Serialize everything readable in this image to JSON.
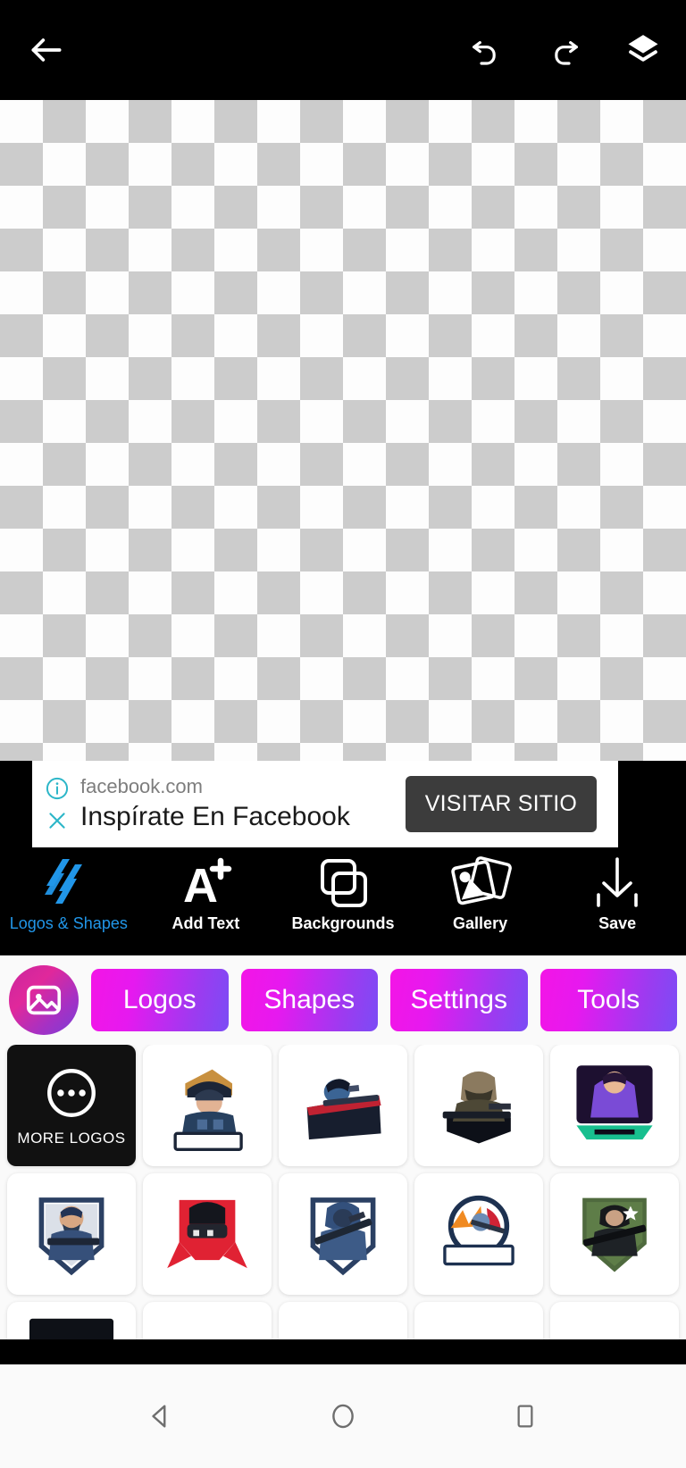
{
  "topbar": {
    "back_icon": "arrow-left-icon",
    "undo_icon": "undo-icon",
    "redo_icon": "redo-icon",
    "layers_icon": "layers-icon"
  },
  "canvas": {
    "state": "transparent-checkerboard"
  },
  "ad": {
    "info_icon": "info-icon",
    "close_icon": "close-icon",
    "url": "facebook.com",
    "title": "Inspírate En Facebook",
    "cta_label": "VISITAR SITIO",
    "cta_bg": "#3c3c3c",
    "accent": "#2cb6c8"
  },
  "toolbar": {
    "items": [
      {
        "label": "Logos & Shapes",
        "icon": "logos-shapes-icon",
        "active": true,
        "color": "#2196e8"
      },
      {
        "label": "Add Text",
        "icon": "add-text-icon",
        "active": false,
        "color": "#ffffff"
      },
      {
        "label": "Backgrounds",
        "icon": "backgrounds-icon",
        "active": false,
        "color": "#ffffff"
      },
      {
        "label": "Gallery",
        "icon": "gallery-icon",
        "active": false,
        "color": "#ffffff"
      },
      {
        "label": "Save",
        "icon": "save-download-icon",
        "active": false,
        "color": "#ffffff"
      }
    ]
  },
  "tabstrip": {
    "gallery_button_icon": "image-picker-icon",
    "tabs": [
      {
        "label": "Logos"
      },
      {
        "label": "Shapes"
      },
      {
        "label": "Settings"
      },
      {
        "label": "Tools"
      }
    ],
    "gradient_start": "#f315e6",
    "gradient_end": "#7b4cf5"
  },
  "grid": {
    "more_label": "MORE LOGOS",
    "more_icon": "ellipsis-circle-icon",
    "items": [
      {
        "name": "more-logos-tile",
        "kind": "more"
      },
      {
        "name": "logo-soldier-helmet-banner",
        "kind": "logo"
      },
      {
        "name": "logo-sniper-dark-badge",
        "kind": "logo"
      },
      {
        "name": "logo-masked-gunman-shield",
        "kind": "logo"
      },
      {
        "name": "logo-neon-soldier-ribbon",
        "kind": "logo"
      },
      {
        "name": "logo-bearded-operator-crest",
        "kind": "logo"
      },
      {
        "name": "logo-red-splatter-helmet",
        "kind": "logo"
      },
      {
        "name": "logo-hooded-sniper-crest",
        "kind": "logo"
      },
      {
        "name": "logo-explosion-banner",
        "kind": "logo"
      },
      {
        "name": "logo-green-shield-star",
        "kind": "logo"
      },
      {
        "name": "logo-dark-visor-partial",
        "kind": "logo"
      },
      {
        "name": "logo-black-arc-partial",
        "kind": "logo"
      },
      {
        "name": "logo-green-dome-partial",
        "kind": "logo"
      },
      {
        "name": "logo-pink-bow-partial",
        "kind": "logo"
      },
      {
        "name": "logo-cyan-wings-partial",
        "kind": "logo"
      }
    ]
  },
  "navbar": {
    "back_icon": "nav-back-triangle-icon",
    "home_icon": "nav-home-circle-icon",
    "recents_icon": "nav-recents-square-icon"
  }
}
